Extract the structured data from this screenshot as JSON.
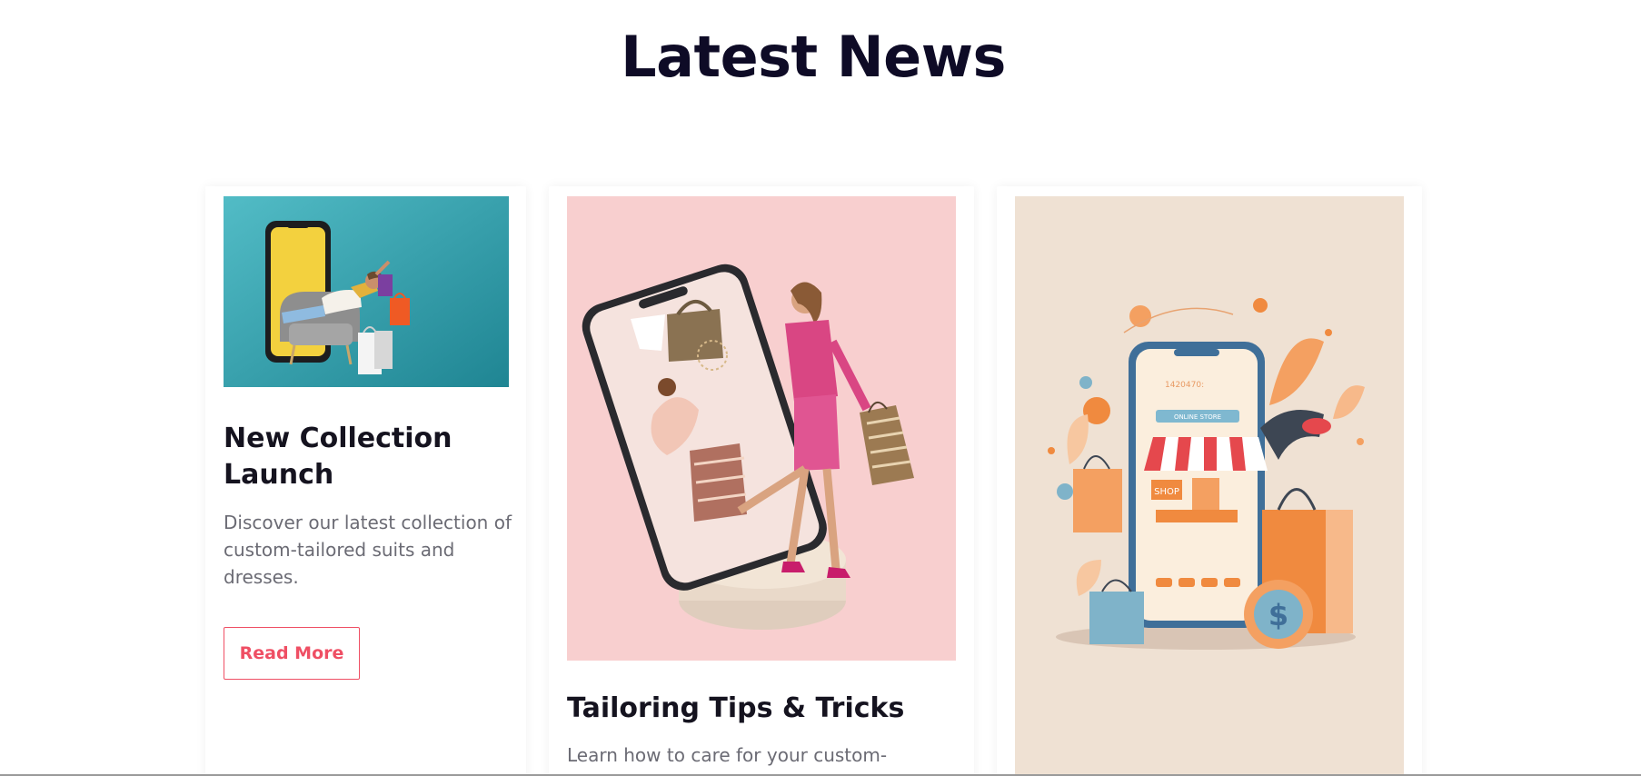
{
  "section": {
    "title": "Latest News"
  },
  "cards": [
    {
      "title": "New Collection Launch",
      "text": "Discover our latest collection of custom-tailored suits and dresses.",
      "button_label": "Read More"
    },
    {
      "title": "Tailoring Tips & Tricks",
      "text": "Learn how to care for your custom-"
    },
    {
      "phone_screen": {
        "code_text": "1420470:",
        "banner_text": "ONLINE STORE",
        "shop_sign": "SHOP"
      }
    }
  ],
  "colors": {
    "heading": "#0e0b26",
    "accent": "#ef4f64",
    "body_text": "#6b6b74",
    "card1_bg": "#2f9aa5",
    "card2_bg": "#f8cfcf",
    "card3_bg": "#efe1d3"
  }
}
